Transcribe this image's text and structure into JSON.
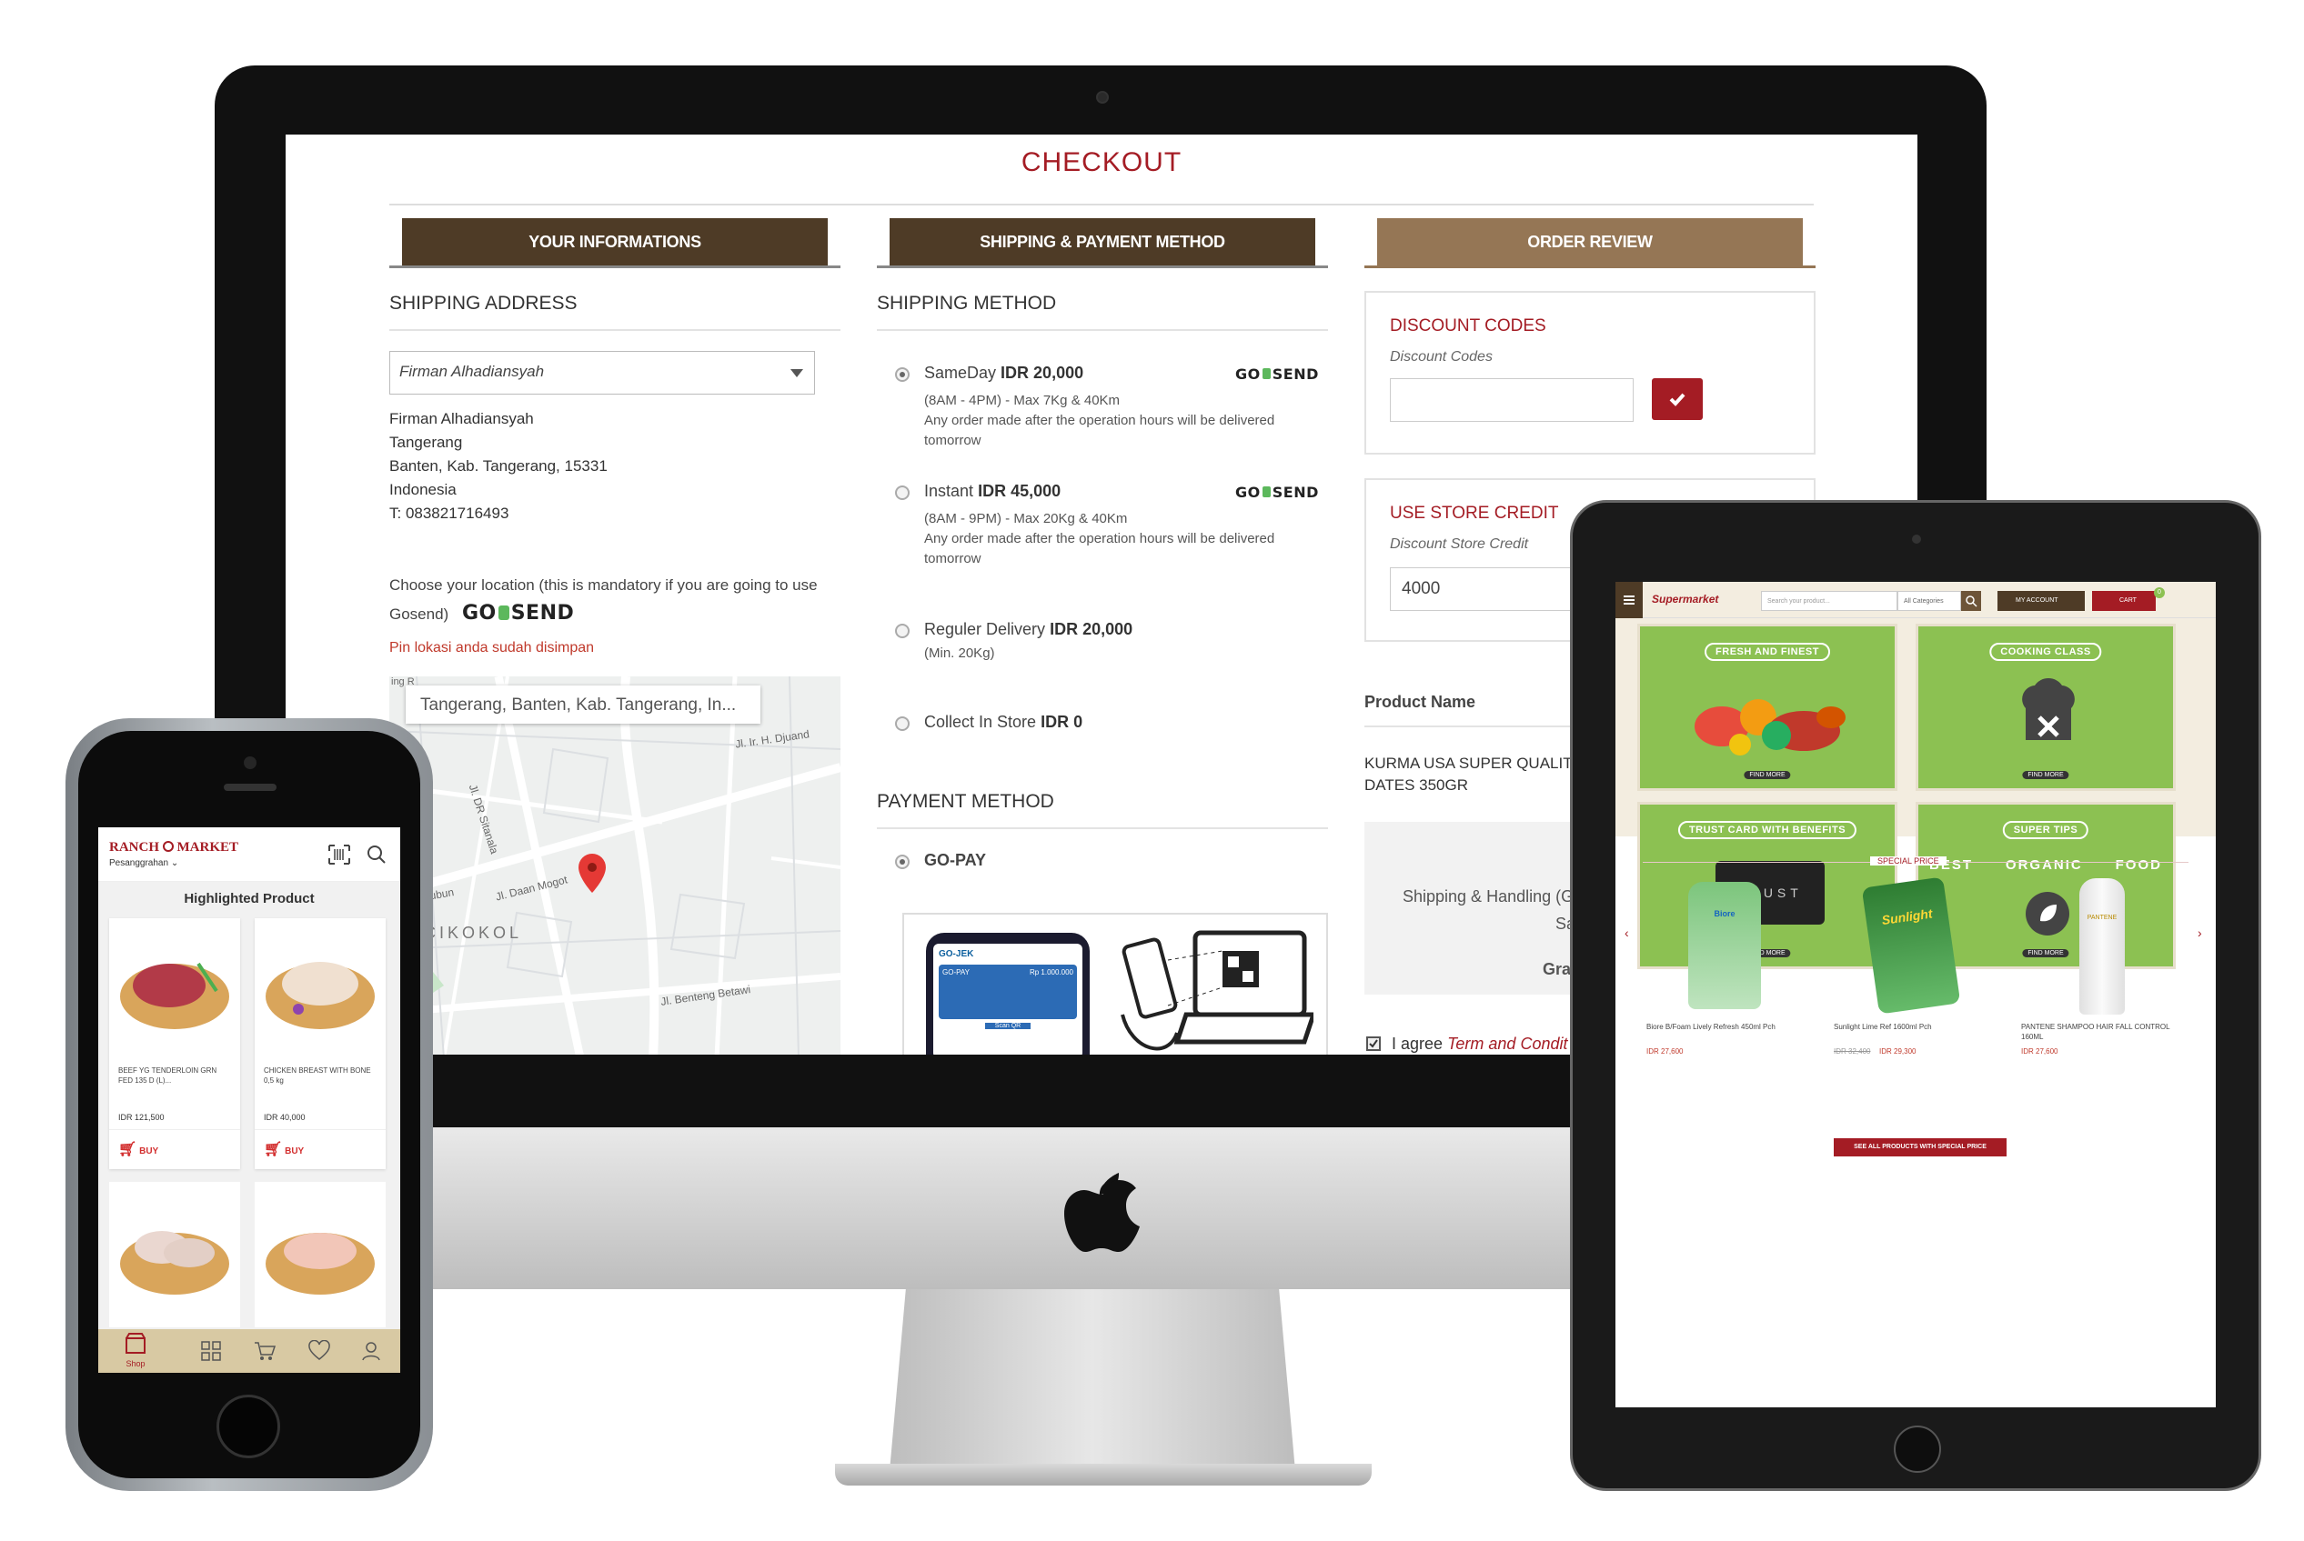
{
  "checkout": {
    "title": "CHECKOUT",
    "steps": [
      "YOUR INFORMATIONS",
      "SHIPPING & PAYMENT METHOD",
      "ORDER REVIEW"
    ],
    "shipping_address": {
      "heading": "SHIPPING ADDRESS",
      "selected": "Firman Alhadiansyah",
      "lines": [
        "Firman Alhadiansyah",
        "Tangerang",
        "Banten, Kab. Tangerang, 15331",
        "Indonesia",
        "T: 083821716493"
      ],
      "location_prompt": "Choose your location (this is mandatory if you are going to use Gosend)",
      "location_saved": "Pin lokasi anda sudah disimpan",
      "map_search": "Tangerang, Banten, Kab. Tangerang, In...",
      "map_labels": [
        "CIKOKOL",
        "Jl. Ir. H. Djuand",
        "Jl. Daan Mogot",
        "Jl. Ks. Tubun",
        "Jl. Benteng Betawi",
        "Jl. DR Sitanala",
        "ing R"
      ]
    },
    "shipping_method": {
      "heading": "SHIPPING METHOD",
      "options": [
        {
          "name": "SameDay",
          "price": "IDR 20,000",
          "sub": [
            "(8AM - 4PM) - Max 7Kg & 40Km",
            "Any order made after the operation hours will be delivered",
            "tomorrow"
          ],
          "logo": true
        },
        {
          "name": "Instant",
          "price": "IDR 45,000",
          "sub": [
            "(8AM - 9PM) - Max 20Kg & 40Km",
            "Any order made after the operation hours will be delivered",
            "tomorrow"
          ],
          "logo": true
        },
        {
          "name": "Reguler Delivery",
          "price": "IDR 20,000",
          "sub": [
            "(Min. 20Kg)"
          ],
          "logo": false
        },
        {
          "name": "Collect In Store",
          "price": "IDR 0",
          "sub": [],
          "logo": false
        }
      ]
    },
    "gosend": {
      "go": "GO",
      "send": "SEND"
    },
    "payment_method": {
      "heading": "PAYMENT METHOD",
      "option": "GO-PAY",
      "gojek": "GO-JEK",
      "gopay": "GO-PAY",
      "gopay_amount": "Rp 1.000.000",
      "scan": "Scan QR"
    },
    "discount": {
      "heading": "DISCOUNT CODES",
      "label": "Discount Codes",
      "value": ""
    },
    "store_credit": {
      "heading": "USE STORE CREDIT",
      "label": "Discount Store Credit",
      "value": "4000"
    },
    "review": {
      "product_name_header": "Product Name",
      "product": "KURMA USA SUPER QUALITY DATES 350GR",
      "shipping_handling": "Shipping & Handling (G",
      "sa": "Sa",
      "grand": "Gra",
      "agree_prefix": "I agree",
      "agree_link": "Term and Condit"
    }
  },
  "phone": {
    "brand_left": "RANCH",
    "brand_right": "MARKET",
    "location": "Pesanggrahan",
    "section_title": "Highlighted Product",
    "products": [
      {
        "name": "BEEF YG TENDERLOIN GRN FED 135 D (L)...",
        "price": "IDR 121,500",
        "buy": "BUY"
      },
      {
        "name": "CHICKEN BREAST WITH BONE 0,5 kg",
        "price": "IDR 40,000",
        "buy": "BUY"
      }
    ],
    "nav": {
      "shop": "Shop"
    }
  },
  "tablet": {
    "logo": "Supermarket",
    "search_placeholder": "Search your product...",
    "category": "All Categories",
    "account": "MY ACCOUNT",
    "cart": "CART",
    "cart_count": "0",
    "banners": [
      {
        "title": "FRESH AND FINEST",
        "cta": "FIND MORE"
      },
      {
        "title": "COOKING CLASS",
        "cta": "FIND MORE"
      },
      {
        "title": "TRUST CARD WITH BENEFITS",
        "cta": "FIND MORE",
        "card_text": "TRUST"
      },
      {
        "title": "SUPER TIPS",
        "cta": "FIND MORE",
        "words": [
          "BEST",
          "ORGANIC",
          "FOOD"
        ]
      }
    ],
    "special_price": "SPECIAL PRICE",
    "products": [
      {
        "name": "Biore B/Foam Lively Refresh 450ml Pch",
        "old": "",
        "price": "IDR 27,600",
        "brand": "Biore"
      },
      {
        "name": "Sunlight Lime Ref 1600ml Pch",
        "old": "IDR 32,400",
        "price": "IDR 29,300",
        "brand": "Sunlight"
      },
      {
        "name": "PANTENE SHAMPOO HAIR FALL CONTROL 160ML",
        "old": "",
        "price": "IDR 27,600",
        "brand": "PANTENE"
      }
    ],
    "see_all": "SEE ALL PRODUCTS WITH SPECIAL PRICE"
  },
  "colors": {
    "brand_red": "#a41c24",
    "step_dark": "#4e3b26",
    "step_light": "#957655",
    "banner_green": "#8cc152"
  }
}
